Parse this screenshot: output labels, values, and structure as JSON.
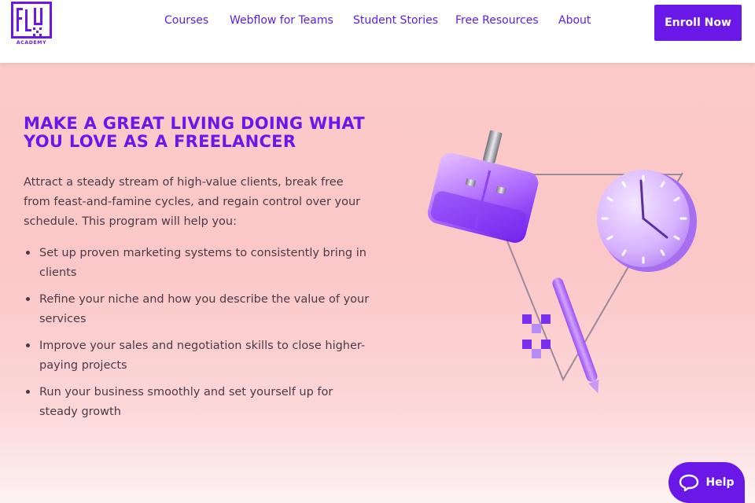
{
  "brand": {
    "logo_text": "FLUX",
    "logo_subtext": "ACADEMY",
    "accent_color": "#6a18e8"
  },
  "nav": {
    "items": [
      {
        "label": "Courses"
      },
      {
        "label": "Webflow for Teams"
      },
      {
        "label": "Student Stories"
      },
      {
        "label": "Free Resources"
      },
      {
        "label": "About"
      }
    ],
    "cta_label": "Enroll Now"
  },
  "hero": {
    "headline": "MAKE A GREAT LIVING DOING WHAT YOU LOVE AS A FREELANCER",
    "intro": "Attract a steady stream of high-value clients, break free from feast-and-famine cycles, and regain control over your schedule. This program will help you:",
    "bullets": [
      "Set up proven marketing systems to consistently bring in clients",
      "Refine your niche and how you describe the value of your services",
      "Improve your sales and negotiation skills to close higher-paying projects",
      "Run your business smoothly and set yourself up for steady growth"
    ]
  },
  "help_widget": {
    "label": "Help",
    "icon": "chat-bubble-icon"
  }
}
